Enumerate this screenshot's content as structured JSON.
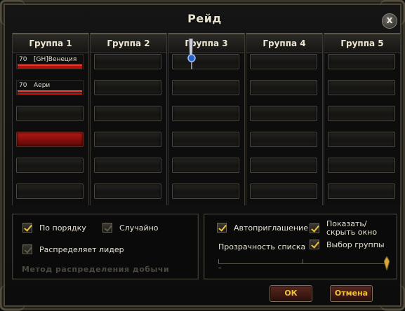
{
  "window": {
    "title": "Рейд",
    "close_label": "x"
  },
  "groups": [
    {
      "label": "Группа 1",
      "members": [
        {
          "level": "70",
          "name": "[GH]Венеция",
          "hp": 1.0,
          "mp": 1.0
        },
        {
          "level": "70",
          "name": "Аери",
          "hp": 1.0,
          "mp": 1.0
        }
      ],
      "highlighted_slot": 4
    },
    {
      "label": "Группа 2",
      "members": []
    },
    {
      "label": "Группа 3",
      "members": []
    },
    {
      "label": "Группа 4",
      "members": []
    },
    {
      "label": "Группа 5",
      "members": []
    }
  ],
  "loot": {
    "in_order": {
      "label": "По порядку",
      "checked": true
    },
    "random": {
      "label": "Случайно",
      "checked": false
    },
    "leader": {
      "label": "Распределяет лидер",
      "checked": false
    },
    "section_label": "Метод распределения добычи"
  },
  "options": {
    "auto_invite": {
      "label": "Автоприглашение",
      "checked": true
    },
    "show_hide": {
      "label": "Показать/ скрыть окно",
      "checked": true
    },
    "group_select": {
      "label": "Выбор группы",
      "checked": true
    },
    "transparency_label": "Прозрачность списка",
    "transparency_min": "–",
    "transparency_value": 1.0
  },
  "buttons": {
    "ok": "ОК",
    "cancel": "Отмена"
  },
  "colors": {
    "accent": "#f0c23a",
    "hp_bar": "#d41a10",
    "highlight": "#a8150f"
  }
}
